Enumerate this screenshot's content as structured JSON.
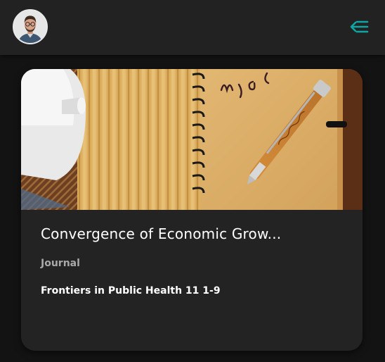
{
  "header": {
    "avatar_icon": "user-avatar",
    "menu_icon": "menu-collapse-icon",
    "accent_color": "#0ea6a2"
  },
  "card": {
    "image_icon": "notebook-pen-photo",
    "title": "Convergence of Economic Grow...",
    "type_label": "Journal",
    "source": "Frontiers in Public Health 11 1-9"
  },
  "colors": {
    "background": "#131313",
    "header_bg": "#222222",
    "card_bg": "#232323",
    "muted_text": "#a9a9a9"
  }
}
